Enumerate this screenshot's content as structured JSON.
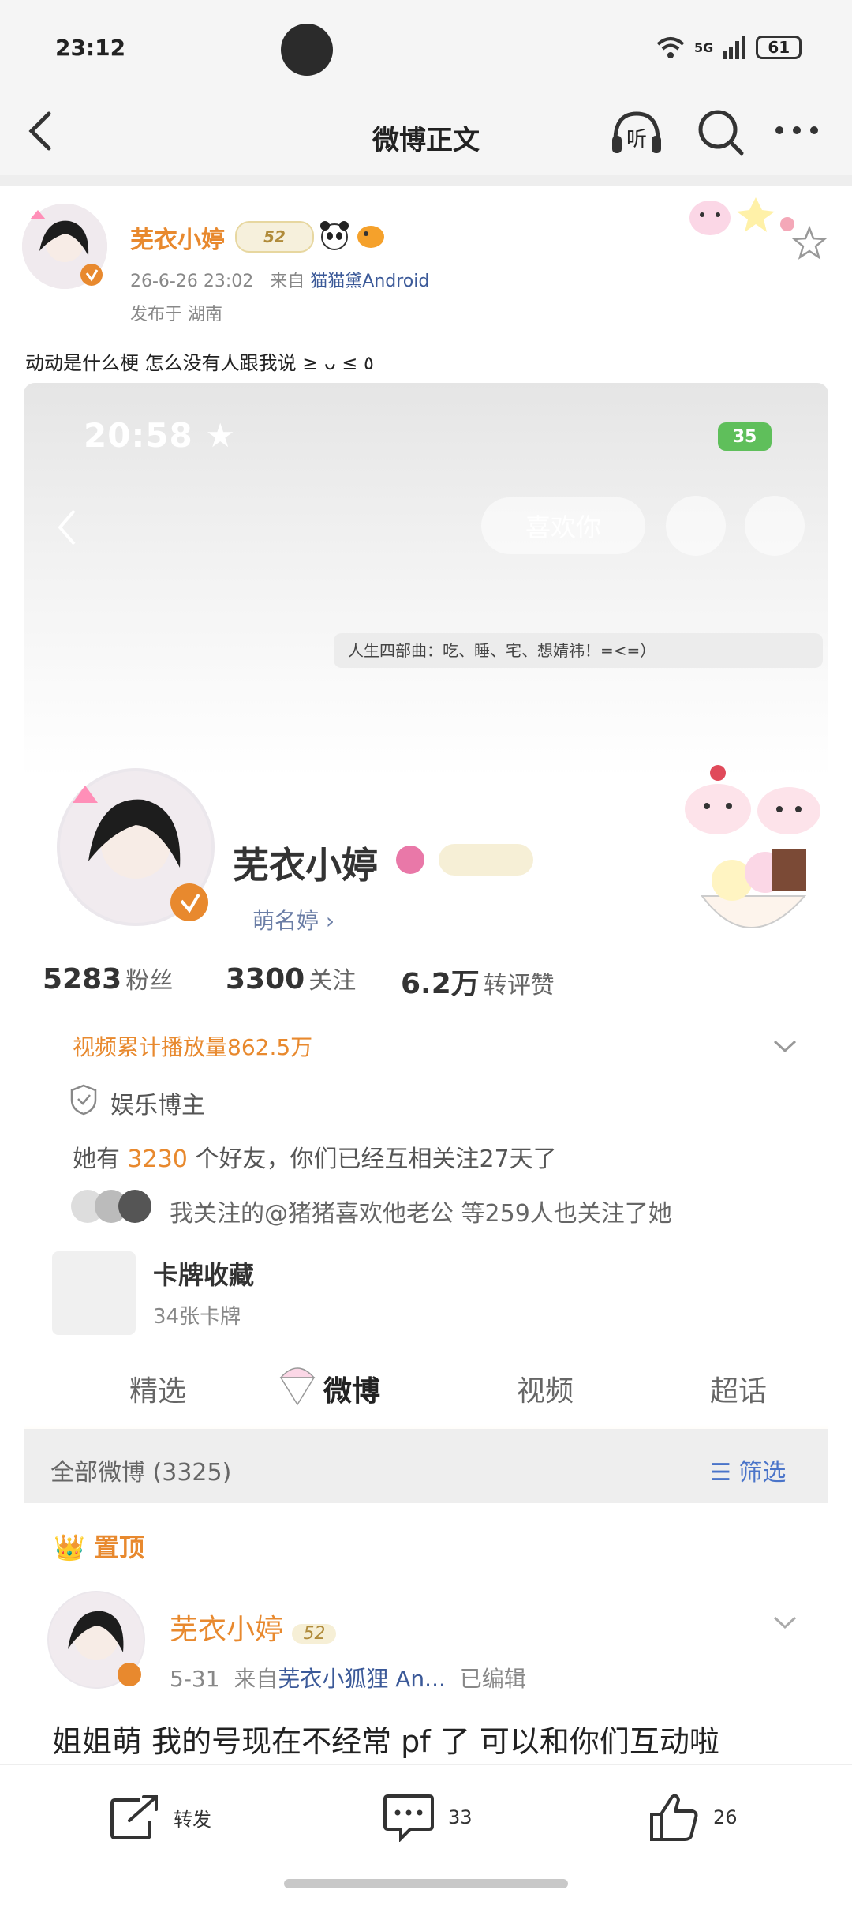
{
  "status": {
    "time": "23:12",
    "network": "5G",
    "battery": "61"
  },
  "nav": {
    "back_icon": "chevron-left-icon",
    "title": "微博正文",
    "listen_label": "听",
    "search_icon": "search-icon",
    "more_icon": "more-icon"
  },
  "post": {
    "author": "芜衣小婷",
    "level_badge": "52",
    "time": "26-6-26 23:02",
    "from_label": "来自",
    "source": "猫猫黛Android",
    "location": "发布于 湖南",
    "text": "动动是什么梗 怎么没有人跟我说 ≥ ᴗ ≤ ٥"
  },
  "embedded": {
    "time": "20:58",
    "battery": "35",
    "like_button": "喜欢你",
    "motto": "人生四部曲：吃、睡、宅、想婧祎！=<=）",
    "name": "芜衣小婷",
    "nickname": "萌名婷 ›",
    "stats": [
      {
        "num": "5283",
        "label": "粉丝"
      },
      {
        "num": "3300",
        "label": "关注"
      },
      {
        "num": "6.2万",
        "label": "转评赞"
      }
    ],
    "play_count": "视频累计播放量862.5万",
    "tag": "娱乐博主",
    "friends_prefix": "她有",
    "friends_count": "3230",
    "friends_suffix": "个好友，你们已经互相关注27天了",
    "follow_line": "我关注的@猪猪喜欢他老公 等259人也关注了她",
    "card_title": "卡牌收藏",
    "card_sub": "34张卡牌",
    "tabs": [
      "精选",
      "微博",
      "视频",
      "超话"
    ],
    "all_posts": "全部微博 (3325)",
    "filter": "筛选",
    "pinned": "置顶",
    "post_name": "芜衣小婷",
    "post_level": "52",
    "post_date": "5-31",
    "post_from": "来自",
    "post_source": "芜衣小狐狸 An...",
    "post_edited": "已编辑",
    "post_text": "姐姐萌  我的号现在不经常 pf 了  可以和你们互动啦"
  },
  "actions": {
    "repost_label": "转发",
    "comment_count": "33",
    "like_count": "26"
  },
  "colors": {
    "accent_orange": "#e8892e",
    "link_blue": "#3b5998",
    "filter_blue": "#4a74c9"
  }
}
